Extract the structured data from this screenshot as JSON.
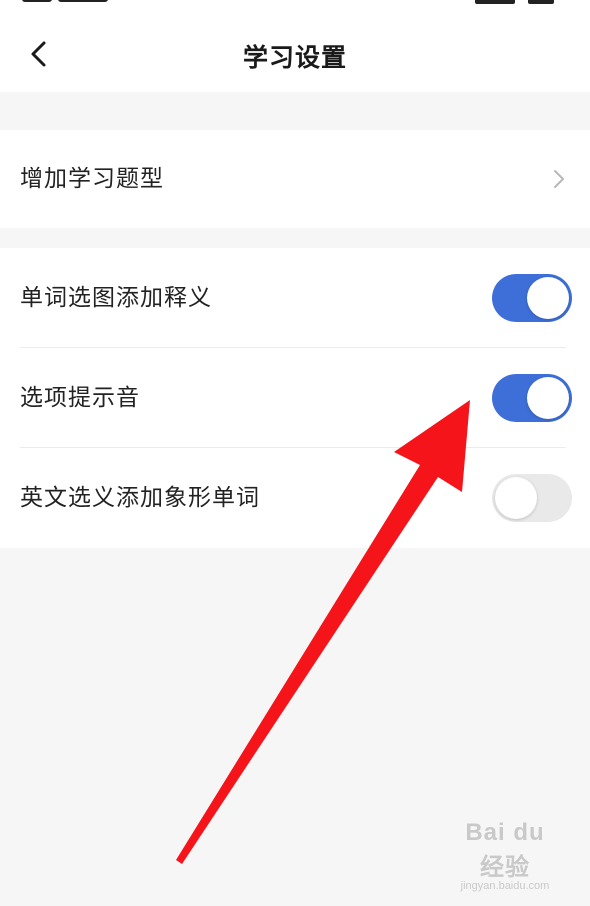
{
  "header": {
    "title": "学习设置",
    "back_icon": "chevron-left-icon"
  },
  "section_1": {
    "items": [
      {
        "label": "增加学习题型",
        "icon": "chevron-right-icon"
      }
    ]
  },
  "section_2": {
    "items": [
      {
        "label": "单词选图添加释义",
        "enabled": true
      },
      {
        "label": "选项提示音",
        "enabled": true
      },
      {
        "label": "英文选义添加象形单词",
        "enabled": false
      }
    ]
  },
  "colors": {
    "toggle_on": "#3e6fd8",
    "toggle_off": "#e9e9e9",
    "annotation_arrow": "#f5141a",
    "background": "#f6f6f6"
  },
  "watermark": {
    "logo": "Bai du 经验",
    "url": "jingyan.baidu.com"
  }
}
